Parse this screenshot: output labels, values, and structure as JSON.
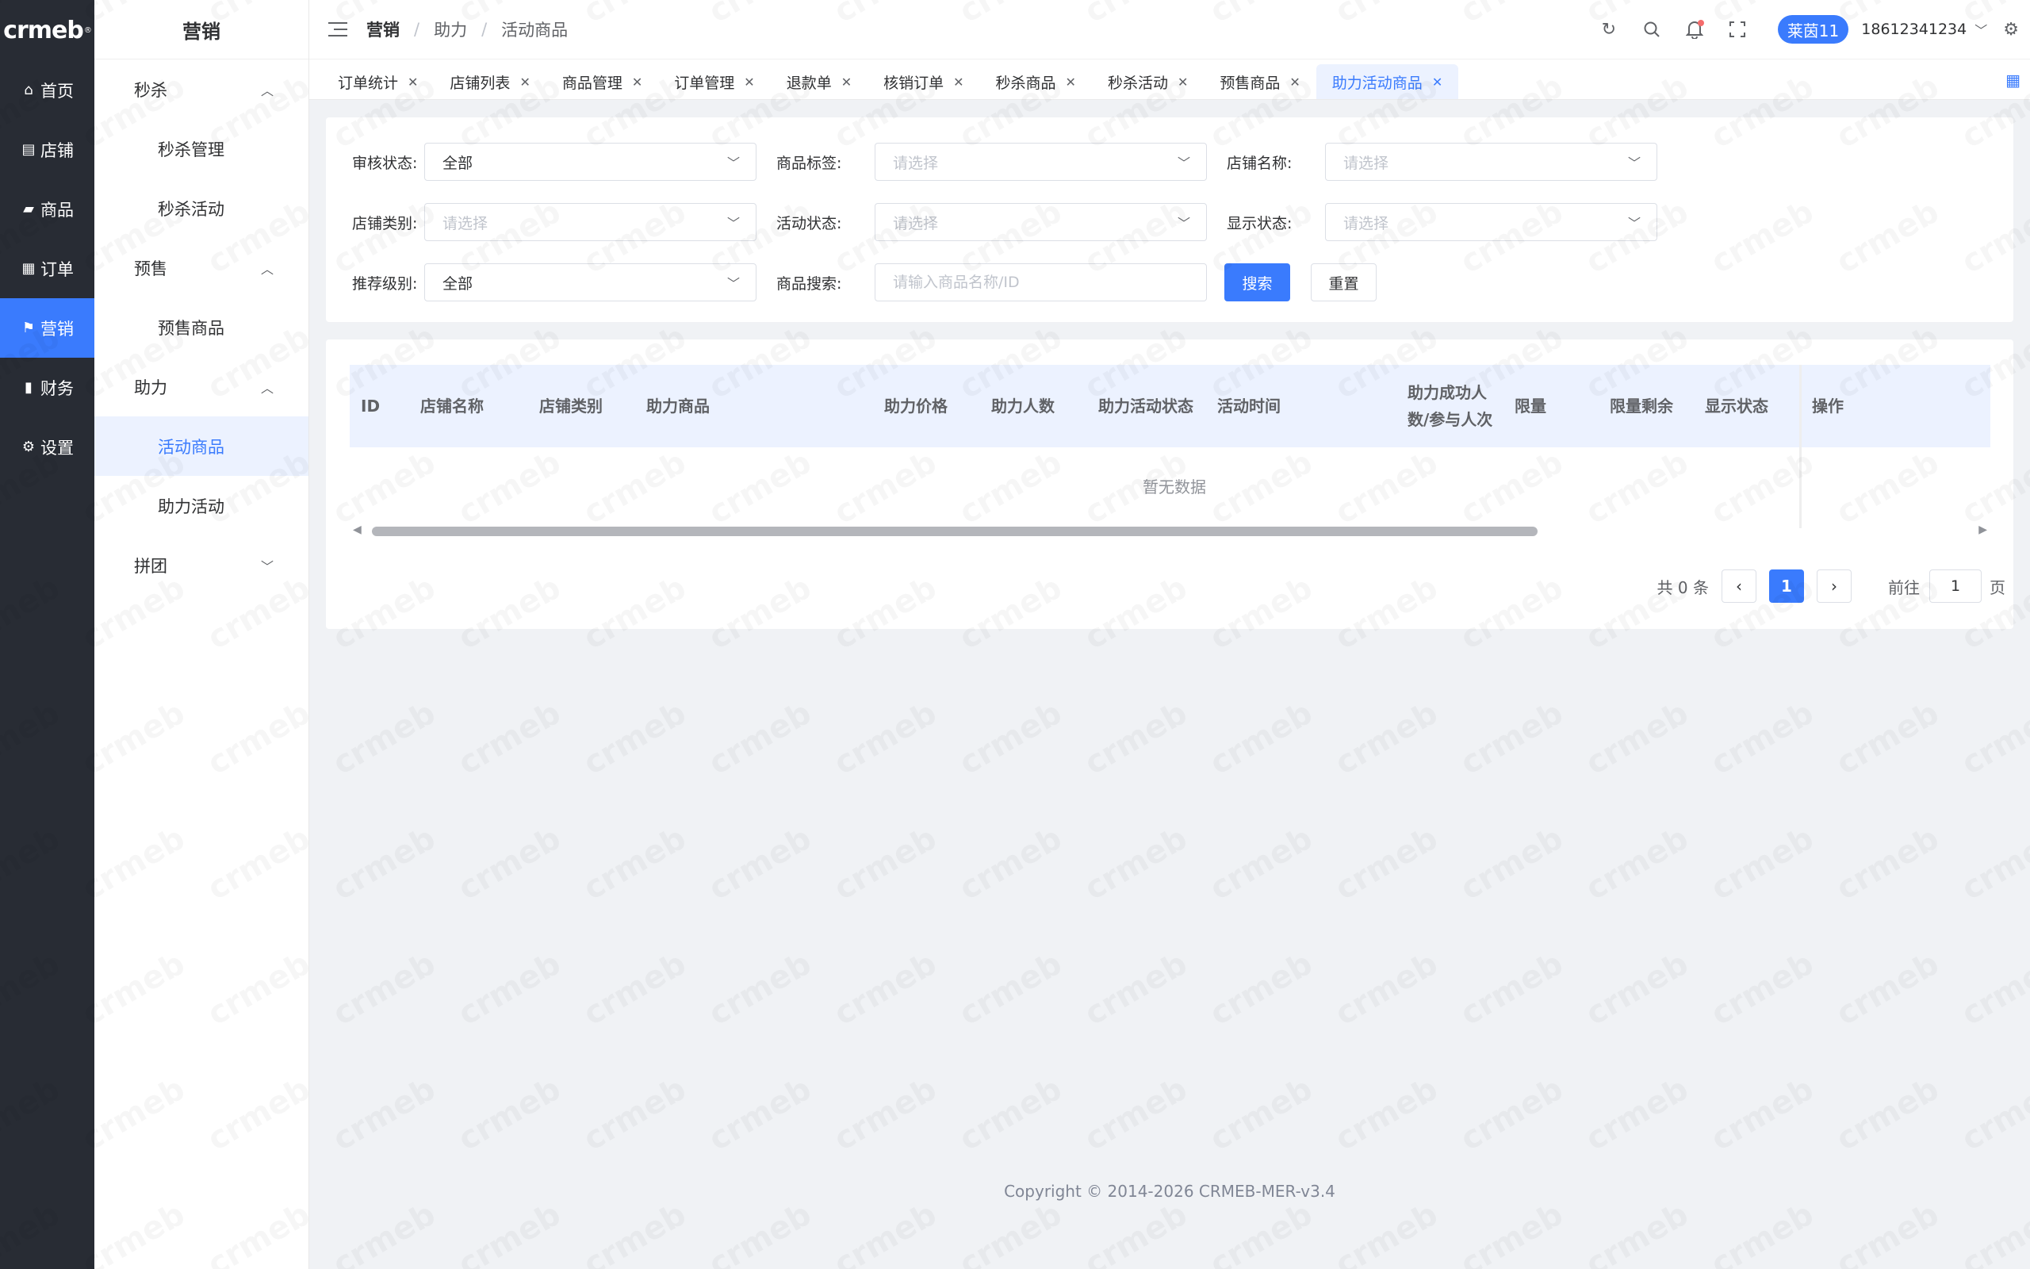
{
  "brand": {
    "logo_text": "crmeb",
    "logo_mark": "®"
  },
  "main_nav": [
    {
      "label": "首页",
      "icon": "home-icon",
      "glyph": "⌂"
    },
    {
      "label": "店铺",
      "icon": "store-icon",
      "glyph": "▤"
    },
    {
      "label": "商品",
      "icon": "bag-icon",
      "glyph": "▰"
    },
    {
      "label": "订单",
      "icon": "clipboard-icon",
      "glyph": "▦"
    },
    {
      "label": "营销",
      "icon": "flag-icon",
      "glyph": "⚑",
      "active": true
    },
    {
      "label": "财务",
      "icon": "bar-chart-icon",
      "glyph": "▮"
    },
    {
      "label": "设置",
      "icon": "gear-icon",
      "glyph": "⚙"
    }
  ],
  "sub_nav": {
    "title": "营销",
    "groups": [
      {
        "label": "秒杀",
        "expanded": true,
        "items": [
          "秒杀管理",
          "秒杀活动"
        ]
      },
      {
        "label": "预售",
        "expanded": true,
        "items": [
          "预售商品"
        ]
      },
      {
        "label": "助力",
        "expanded": true,
        "items": [
          "活动商品",
          "助力活动"
        ]
      },
      {
        "label": "拼团",
        "expanded": false,
        "items": []
      }
    ],
    "active_item": "活动商品"
  },
  "header": {
    "breadcrumb_root": "营销",
    "breadcrumb": [
      "助力",
      "活动商品"
    ],
    "user_badge": "莱茵11",
    "user_phone": "18612341234"
  },
  "tabs": [
    {
      "label": "订单统计"
    },
    {
      "label": "店铺列表"
    },
    {
      "label": "商品管理"
    },
    {
      "label": "订单管理"
    },
    {
      "label": "退款单"
    },
    {
      "label": "核销订单"
    },
    {
      "label": "秒杀商品"
    },
    {
      "label": "秒杀活动"
    },
    {
      "label": "预售商品"
    },
    {
      "label": "助力活动商品",
      "active": true
    }
  ],
  "filters": {
    "audit_status": {
      "label": "审核状态:",
      "value": "全部"
    },
    "product_tag": {
      "label": "商品标签:",
      "placeholder": "请选择"
    },
    "store_name": {
      "label": "店铺名称:",
      "placeholder": "请选择"
    },
    "store_type": {
      "label": "店铺类别:",
      "placeholder": "请选择"
    },
    "activity_status": {
      "label": "活动状态:",
      "placeholder": "请选择"
    },
    "display_status": {
      "label": "显示状态:",
      "placeholder": "请选择"
    },
    "recommend_level": {
      "label": "推荐级别:",
      "value": "全部"
    },
    "product_search": {
      "label": "商品搜索:",
      "placeholder": "请输入商品名称/ID"
    },
    "search_button": "搜索",
    "reset_button": "重置"
  },
  "table": {
    "columns": [
      "ID",
      "店铺名称",
      "店铺类别",
      "助力商品",
      "助力价格",
      "助力人数",
      "助力活动状态",
      "活动时间",
      "助力成功人\n数/参与人次",
      "限量",
      "限量剩余",
      "显示状态",
      "操作"
    ],
    "rows": [],
    "empty_text": "暂无数据"
  },
  "pagination": {
    "total_text": "共 0 条",
    "current_page": "1",
    "goto_label": "前往",
    "goto_value": "1",
    "page_suffix": "页"
  },
  "footer": {
    "copyright": "Copyright © 2014-2026 CRMEB-MER-v3.4"
  },
  "colors": {
    "primary": "#3a7bfd",
    "nav_bg": "#282c34",
    "active_bg": "#ecf2ff"
  }
}
